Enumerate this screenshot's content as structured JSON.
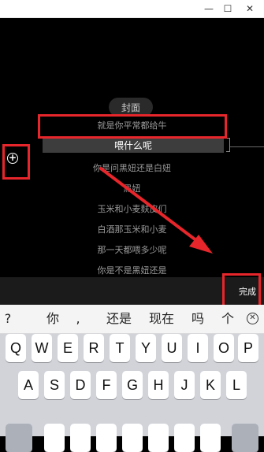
{
  "window": {
    "minimize_glyph": "—",
    "maximize_glyph": "☐",
    "close_glyph": "✕"
  },
  "editor": {
    "cover_label": "封面",
    "lyrics_above": [
      "就是你平常都给牛"
    ],
    "active_lyric": "喂什么呢",
    "lyrics_below": [
      "你是问黑妞还是白妞",
      "黑妞",
      "玉米和小麦麸皮们",
      "白酒那玉米和小麦",
      "那一天都喂多少呢",
      "你是不是黑妞还是"
    ],
    "add_button_glyph": "+",
    "done_label": "完成"
  },
  "keyboard": {
    "candidates": [
      "?",
      "你",
      ",",
      "还是",
      "现在",
      "吗",
      "个"
    ],
    "row1": [
      "Q",
      "W",
      "E",
      "R",
      "T",
      "Y",
      "U",
      "I",
      "O",
      "P"
    ],
    "row2": [
      "A",
      "S",
      "D",
      "F",
      "G",
      "H",
      "J",
      "K",
      "L"
    ],
    "clear_glyph": "✕"
  },
  "annotation_color": "#e6262b"
}
